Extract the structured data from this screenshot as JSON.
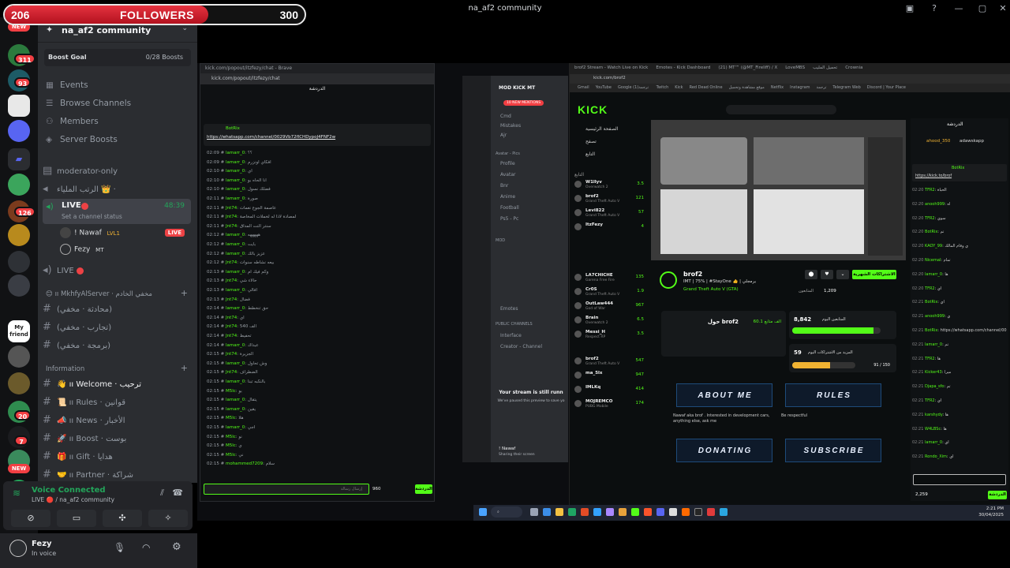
{
  "window": {
    "title": "na_af2 community"
  },
  "followers_goal": {
    "current": "206",
    "label": "FOLLOWERS",
    "goal": "300",
    "progress": 0.68
  },
  "server_rail": {
    "badges": [
      {
        "label": "NEW"
      },
      {
        "label": "311"
      },
      {
        "label": "93"
      },
      {
        "label": "126"
      },
      {
        "label": "20"
      },
      {
        "label": "7"
      },
      {
        "label": "NEW"
      }
    ]
  },
  "sidebar": {
    "server_name": "na_af2 community",
    "boost_goal_label": "Boost Goal",
    "boost_count": "0/28 Boosts",
    "nav": [
      "Events",
      "Browse Channels",
      "Members",
      "Server Boosts"
    ],
    "channels_top": [
      {
        "name": "moderator-only"
      },
      {
        "name": "الرتب الملياء 👑 ·"
      }
    ],
    "live_channel": {
      "name": "LIVE",
      "timer": "48:39",
      "status_placeholder": "Set a channel status"
    },
    "voice_users": [
      {
        "name": "! Nawaf",
        "tag": "LVL1",
        "live": "LIVE"
      },
      {
        "name": "Fezy",
        "tag": "MT"
      }
    ],
    "live_channel_2": "LIVE",
    "category_1": "😊 ıı MkhfyAlServer · مخفي الخادم",
    "channels_hidden": [
      "(محادثة · مخفي)",
      "(تجارب · مخفي)",
      "(برمجة · مخفي)"
    ],
    "category_2": "Information",
    "channels_info": [
      "👋 ıı Welcome · ترحيب",
      "📜 ıı Rules · قوانين",
      "📣 ıı News · الأخبار",
      "🚀 ıı Boost · بوست",
      "🎁 ıı Gift · هدايا",
      "🤝 ıı Partner · شراكة"
    ]
  },
  "voice_panel": {
    "status": "Voice Connected",
    "location": "LIVE 🔴 / na_af2 community"
  },
  "user_bar": {
    "name": "Fezy",
    "status": "In voice"
  },
  "popout": {
    "title": "kick.com/popout/itzfezy/chat - Brave",
    "url": "kick.com/popout/itzfezy/chat",
    "header": "الدردشة",
    "pinned_user": "BotRix",
    "pinned_link": "https://whatsapp.com/channel/0029Vb72fICHDypoJ4FNF2w",
    "messages": [
      {
        "time": "02:09",
        "user": "lamarr_0",
        "text": "؟؟"
      },
      {
        "time": "02:09",
        "user": "lamarr_0",
        "text": "افكاي اونزرم"
      },
      {
        "time": "02:10",
        "user": "lamarr_0",
        "text": "اي"
      },
      {
        "time": "02:10",
        "user": "lamarr_0",
        "text": "انا الحاه بو"
      },
      {
        "time": "02:10",
        "user": "lamarr_0",
        "text": "فضلك نسول"
      },
      {
        "time": "02:11",
        "user": "lamarr_0",
        "text": "صورة"
      },
      {
        "time": "02:11",
        "user": "Jnt74",
        "text": "عاصمة الجوع نغمات"
      },
      {
        "time": "02:11",
        "user": "Jnt74",
        "text": "لمصادة لاذا له لخملات المخاصة"
      },
      {
        "time": "02:11",
        "user": "Jnt74",
        "text": "سنتر النت المداق"
      },
      {
        "time": "02:12",
        "user": "lamarr_0",
        "text": "هههههه"
      },
      {
        "time": "02:12",
        "user": "lamarr_0",
        "text": "بايت"
      },
      {
        "time": "02:12",
        "user": "lamarr_0",
        "text": "عزيز بالك"
      },
      {
        "time": "02:12",
        "user": "Jnt74",
        "text": "بيعه نشاطه سنوات"
      },
      {
        "time": "02:13",
        "user": "lamarr_0",
        "text": "وكم فيك ام"
      },
      {
        "time": "02:13",
        "user": "Jnt74",
        "text": "حالاء شي"
      },
      {
        "time": "02:13",
        "user": "lamarr_0",
        "text": "افالي"
      },
      {
        "time": "02:13",
        "user": "Jnt74",
        "text": "فضال"
      },
      {
        "time": "02:14",
        "user": "lamarr_0",
        "text": "حق تنخطط"
      },
      {
        "time": "02:14",
        "user": "Jnt74",
        "text": "اي"
      },
      {
        "time": "02:14",
        "user": "Jnt74",
        "text": "540 الف"
      },
      {
        "time": "02:14",
        "user": "Jnt74",
        "text": "تحفيظ"
      },
      {
        "time": "02:14",
        "user": "lamarr_0",
        "text": "عبداك"
      },
      {
        "time": "02:15",
        "user": "Jnt74",
        "text": "الجزيرة"
      },
      {
        "time": "02:15",
        "user": "lamarr_0",
        "text": "وش تحاول"
      },
      {
        "time": "02:15",
        "user": "Jnt74",
        "text": "الضطراف"
      },
      {
        "time": "02:15",
        "user": "lamarr_0",
        "text": "بالنكبه تبنا"
      },
      {
        "time": "02:15",
        "user": "M5lc",
        "text": "بو"
      },
      {
        "time": "02:15",
        "user": "lamarr_0",
        "text": "يتقال"
      },
      {
        "time": "02:15",
        "user": "lamarr_0",
        "text": "يقين"
      },
      {
        "time": "02:15",
        "user": "M5lc",
        "text": "هلا"
      },
      {
        "time": "02:15",
        "user": "lamarr_0",
        "text": "اجي"
      },
      {
        "time": "02:15",
        "user": "M5lc",
        "text": "نو"
      },
      {
        "time": "02:15",
        "user": "M5lc",
        "text": "ي"
      },
      {
        "time": "02:15",
        "user": "M5lc",
        "text": "ني"
      },
      {
        "time": "02:15",
        "user": "mohammed7209",
        "text": "سلام"
      }
    ],
    "input_placeholder": "إرسال رسالة",
    "points": "960",
    "send_label": "الدردشة"
  },
  "discord_mini": {
    "server": "MOD KICK MT",
    "mentions": "10 NEW MENTIONS",
    "channels": [
      "Cmd",
      "Mistakes",
      "Ajr",
      "Profile",
      "Avatar",
      "Bnr",
      "Anime",
      "Football",
      "Ps5 - Pc",
      "Emotes",
      "Interface",
      "Creator - Channel"
    ],
    "categories": [
      "Avatar - Pics",
      "MOD",
      "PUBLIC CHANNELS"
    ],
    "stream_paused_title": "Your stream is still runn",
    "stream_paused_sub": "We've paused this preview to save yo",
    "user_name": "! Nawaf",
    "user_status": "Sharing their screen"
  },
  "kick": {
    "tabs": [
      "brof2 Stream - Watch Live on Kick",
      "Emotes - Kick Dashboard",
      "(21) MT™ (@MT_Fireliff) / X",
      "LoveMBS",
      "تحميل المليب",
      "Crownia"
    ],
    "url": "kick.com/brof2",
    "bookmarks": [
      "Gmail",
      "YouTube",
      "Google ترجمة",
      "(1) Twitch",
      "Kick",
      "Red Dead Online",
      "موقع مشاهدة وتحميل",
      "Netflix",
      "Instagram",
      "ترجمة",
      "Telegram Web",
      "Discord | Your Place"
    ],
    "logo": "KICK",
    "nav": [
      "الصفحة الرئيسية",
      "تصفح",
      "التابع"
    ],
    "following_label": "التابع",
    "following": [
      {
        "name": "W1llyv",
        "game": "Overwatch 2",
        "viewers": "3.5"
      },
      {
        "name": "brof2",
        "game": "Grand Theft Auto V",
        "viewers": "121"
      },
      {
        "name": "Levi822",
        "game": "Grand Theft Auto V",
        "viewers": "57"
      },
      {
        "name": "ItzFezy",
        "game": "",
        "viewers": "4"
      },
      {
        "name": "LA7CHICHE",
        "game": "Garena Free Fire",
        "viewers": "135"
      },
      {
        "name": "Cr0S",
        "game": "Grand Theft Auto V",
        "viewers": "1.9"
      },
      {
        "name": "OutLaw444",
        "game": "God of War",
        "viewers": "967"
      },
      {
        "name": "Brain",
        "game": "Overwatch 2",
        "viewers": "6.5"
      },
      {
        "name": "Messi_H",
        "game": "Respect RP",
        "viewers": "3.5"
      },
      {
        "name": "brof2",
        "game": "Grand Theft Auto V",
        "viewers": "547"
      },
      {
        "name": "ma_5lx",
        "game": "",
        "viewers": "947"
      },
      {
        "name": "IMLKq",
        "game": "",
        "viewers": "414"
      },
      {
        "name": "MOJREMCO",
        "game": "PUBG Mobile",
        "viewers": "174"
      }
    ],
    "streamer": "brof2",
    "stream_title": "IMT | 75% | #StayOne 👍 | برمجلي",
    "stream_game": "Grand Theft Auto V (GTA)",
    "viewers": "1,209",
    "followers_label": "المتابعون",
    "follow_button": "الاشتراكات الشهرية",
    "about_title": "حول brof2",
    "about_followers": "60.1 الف متابع",
    "goal_followers": "8,842",
    "goal_followers_label": "المتابعين اليوم",
    "goal_subs_value": "59",
    "goal_subs_label": "المزيد من الاشتراكات اليوم",
    "goal_subs_of": "91 / 150",
    "panels": [
      "ABOUT ME",
      "RULES",
      "DONATING",
      "SUBSCRIBE"
    ],
    "panel_about_text": "Nawaf aka brof . Interested in development cars, anything else, ask me",
    "panel_rules_text": "Be respectful",
    "chat_header": "الدردشة",
    "chat_top_user": "ahood_350",
    "chat_top_user_2": "adawskapp",
    "chat_pinned": "BotRix",
    "chat_link": "https://kick.to/brof",
    "chat_messages": [
      {
        "time": "02:20",
        "user": "TFR2",
        "text": "الحياة"
      },
      {
        "time": "02:20",
        "user": "anooh999",
        "text": "اه"
      },
      {
        "time": "02:20",
        "user": "TFR2",
        "text": "سوي"
      },
      {
        "time": "02:20",
        "user": "BotRix",
        "text": "تم"
      },
      {
        "time": "02:20",
        "user": "KAOY_99",
        "text": "ي وقام المالك"
      },
      {
        "time": "02:20",
        "user": "Nicemal",
        "text": "تمام"
      },
      {
        "time": "02:20",
        "user": "lamarr_0",
        "text": "ها"
      },
      {
        "time": "02:20",
        "user": "TFR2",
        "text": "اي"
      },
      {
        "time": "02:21",
        "user": "BotRix",
        "text": "اي"
      },
      {
        "time": "02:21",
        "user": "anooh999",
        "text": "ي"
      },
      {
        "time": "02:21",
        "user": "BotRix",
        "text": "https://whatsapp.com/channel/0029VaeCWavG"
      },
      {
        "time": "02:21",
        "user": "lamarr_0",
        "text": "تم"
      },
      {
        "time": "02:21",
        "user": "TFR2",
        "text": "ها"
      },
      {
        "time": "02:21",
        "user": "Kicker43",
        "text": "ميرا"
      },
      {
        "time": "02:21",
        "user": "Djapa_sfo",
        "text": "تم"
      },
      {
        "time": "02:21",
        "user": "TFR2",
        "text": "اي"
      },
      {
        "time": "02:21",
        "user": "karshydy",
        "text": "ها"
      },
      {
        "time": "02:21",
        "user": "W4LBSc",
        "text": "ها"
      },
      {
        "time": "02:21",
        "user": "lamarr_0",
        "text": "اي"
      },
      {
        "time": "02:21",
        "user": "Rondo_Xim",
        "text": "اي"
      }
    ],
    "chat_points": "2,259",
    "chat_send": "الدردشة"
  },
  "taskbar": {
    "time": "2:21 PM",
    "date": "30/04/2025"
  },
  "colors": {
    "kick_green": "#53fc18",
    "discord_green": "#23a55a",
    "live_red": "#ed4245",
    "follower_bar": "#d8202e"
  }
}
